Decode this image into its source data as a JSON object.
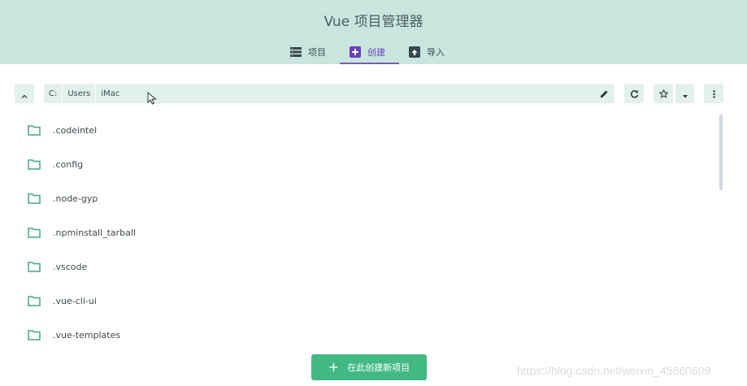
{
  "header": {
    "title": "Vue 项目管理器",
    "tabs": [
      {
        "label": "项目",
        "icon": "list-icon",
        "active": false
      },
      {
        "label": "创建",
        "icon": "add-box-icon",
        "active": true
      },
      {
        "label": "导入",
        "icon": "unarchive-icon",
        "active": false
      }
    ]
  },
  "path": {
    "crumbs": [
      "C:",
      "Users",
      "iMac"
    ]
  },
  "folders": [
    ".codeintel",
    ".config",
    ".node-gyp",
    ".npminstall_tarball",
    ".vscode",
    ".vue-cli-ui",
    ".vue-templates"
  ],
  "actions": {
    "create_here": "在此创建新项目"
  },
  "watermark": "https://blog.csdn.net/weixin_45860609",
  "colors": {
    "header_bg": "#c8e6de",
    "accent": "#42b983",
    "tab_active": "#7e57c2",
    "toolbar_bg": "#e3f1ed"
  }
}
